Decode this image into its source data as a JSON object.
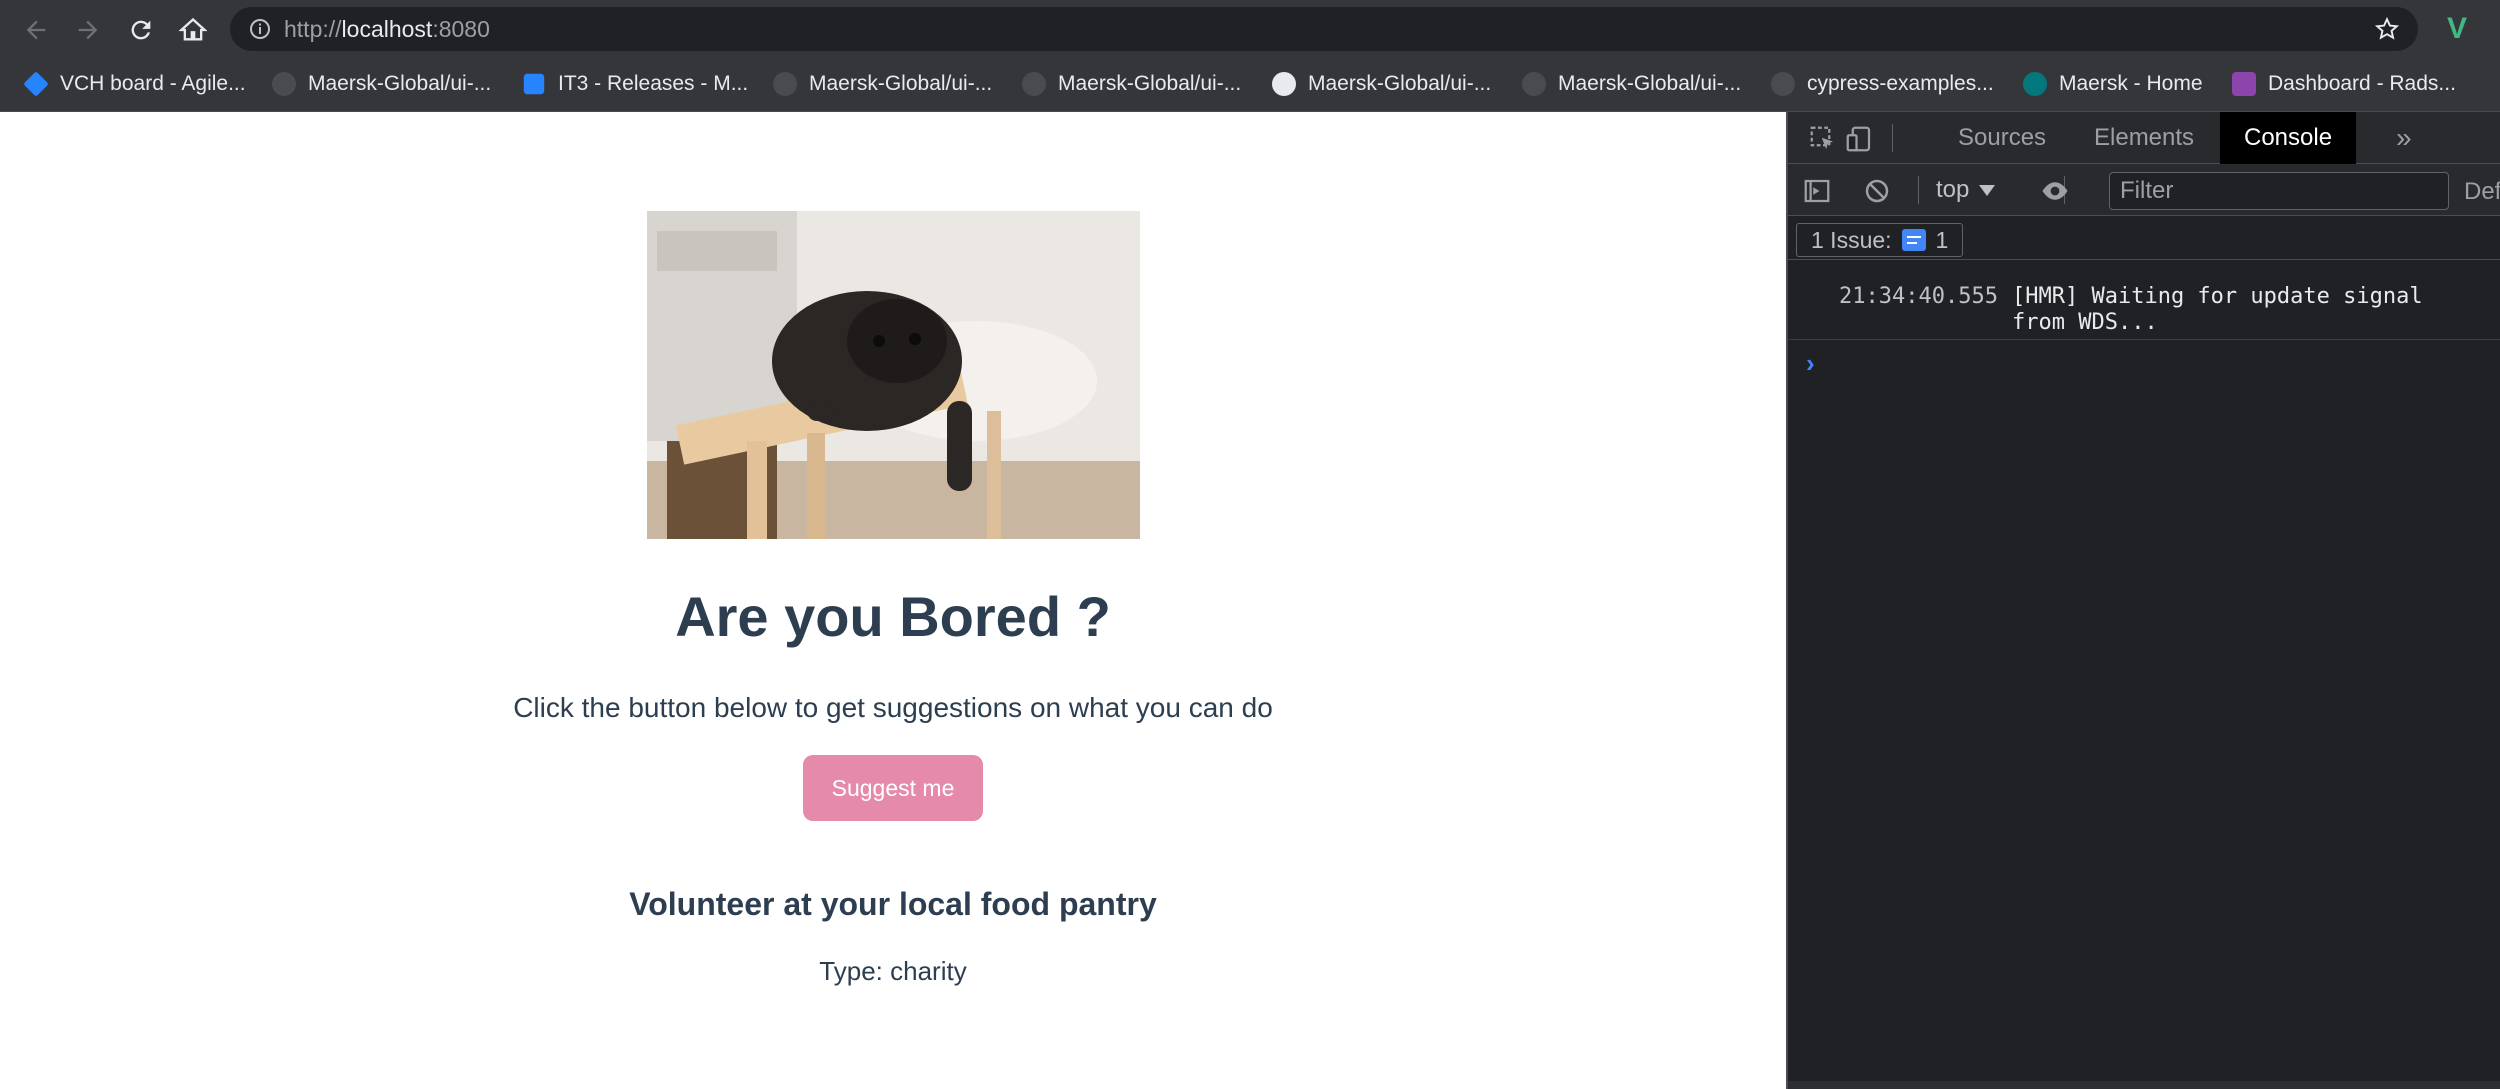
{
  "browser": {
    "url_scheme": "http://",
    "url_host": "localhost",
    "url_port": ":8080",
    "bookmarks": [
      {
        "label": "VCH board - Agile..."
      },
      {
        "label": "Maersk-Global/ui-..."
      },
      {
        "label": "IT3 - Releases - M..."
      },
      {
        "label": "Maersk-Global/ui-..."
      },
      {
        "label": "Maersk-Global/ui-..."
      },
      {
        "label": "Maersk-Global/ui-..."
      },
      {
        "label": "Maersk-Global/ui-..."
      },
      {
        "label": "cypress-examples..."
      },
      {
        "label": "Maersk - Home"
      },
      {
        "label": "Dashboard - Rads..."
      }
    ]
  },
  "app": {
    "title": "Are you Bored ?",
    "subtitle": "Click the button below to get suggestions on what you can do",
    "button_label": "Suggest me",
    "button_color": "#e58aaa",
    "text_color": "#2c3e50",
    "activity": "Volunteer at your local food pantry",
    "activity_type": "Type: charity"
  },
  "devtools": {
    "tabs": [
      "Sources",
      "Elements",
      "Console"
    ],
    "active_tab": "Console",
    "context": "top",
    "filter_placeholder": "Filter",
    "levels_label": "Def",
    "issues_label": "1 Issue:",
    "issues_count": "1",
    "log": {
      "time": "21:34:40.555",
      "message": "[HMR] Waiting for update signal from WDS..."
    },
    "prompt": "›"
  }
}
